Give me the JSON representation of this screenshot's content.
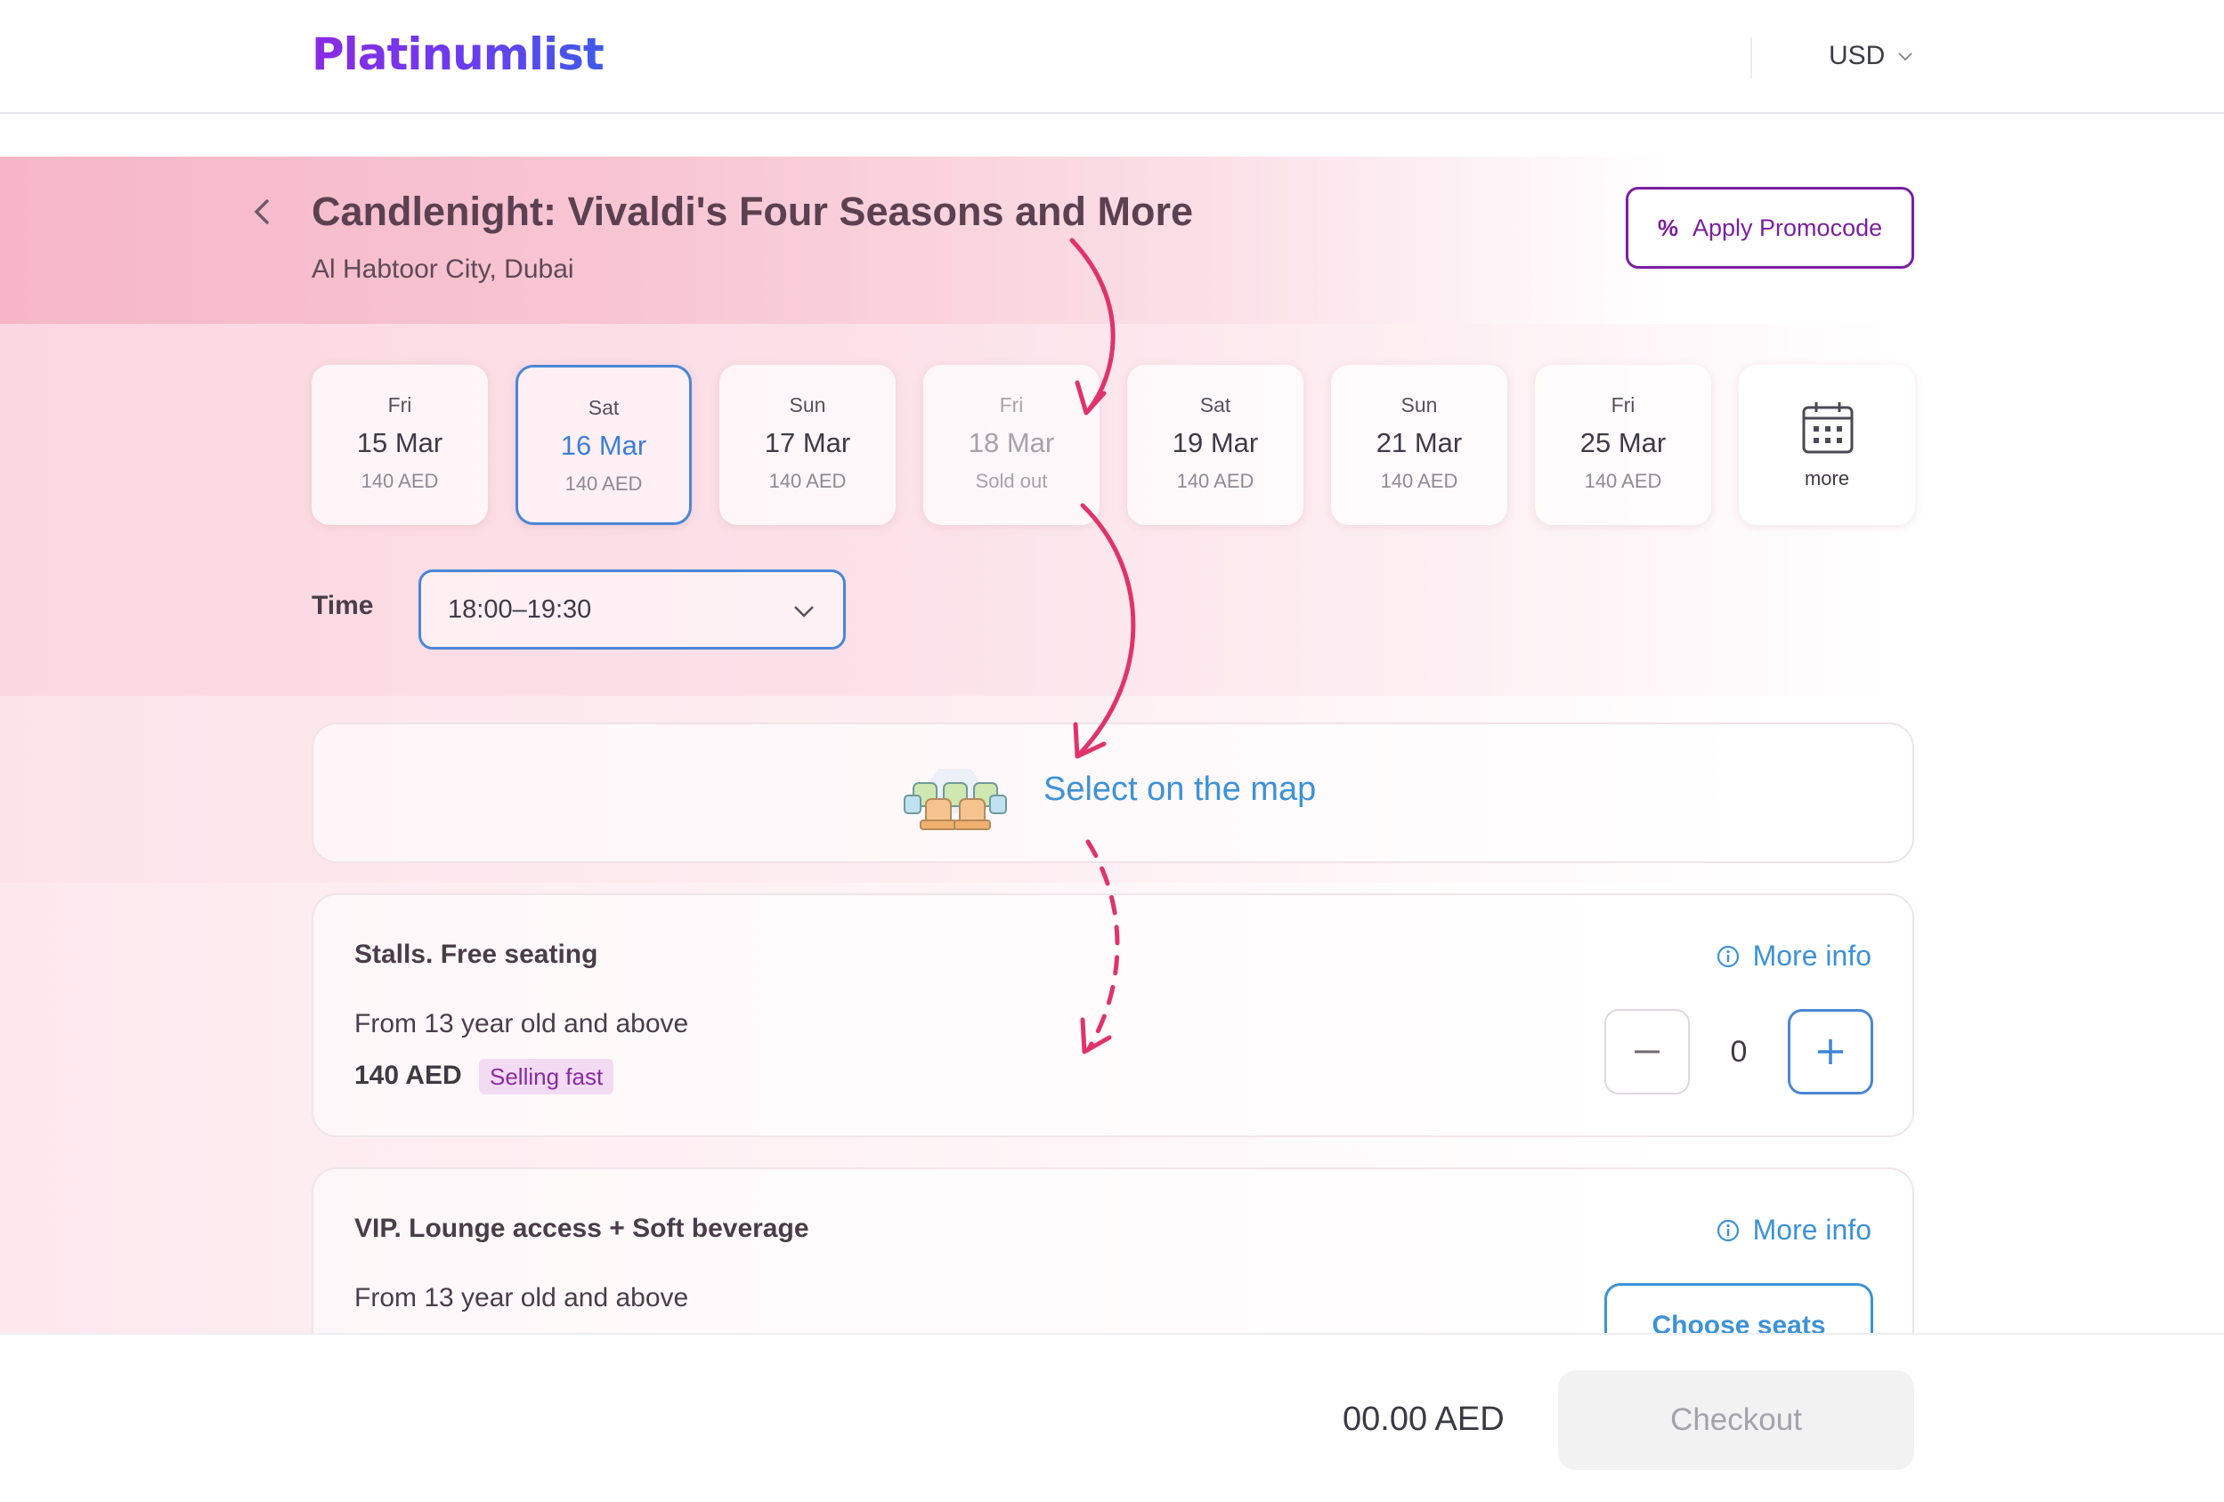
{
  "header": {
    "logo": "Platinumlist",
    "currency": "USD"
  },
  "event": {
    "title": "Candlenight: Vivaldi's Four Seasons and More",
    "venue": "Al Habtoor City, Dubai",
    "promo_label": "Apply Promocode"
  },
  "dates": [
    {
      "dow": "Fri",
      "date": "15 Mar",
      "price": "140 AED",
      "state": "available"
    },
    {
      "dow": "Sat",
      "date": "16 Mar",
      "price": "140 AED",
      "state": "selected"
    },
    {
      "dow": "Sun",
      "date": "17 Mar",
      "price": "140 AED",
      "state": "available"
    },
    {
      "dow": "Fri",
      "date": "18 Mar",
      "price": "Sold out",
      "state": "soldout"
    },
    {
      "dow": "Sat",
      "date": "19 Mar",
      "price": "140 AED",
      "state": "available"
    },
    {
      "dow": "Sun",
      "date": "21 Mar",
      "price": "140 AED",
      "state": "available"
    },
    {
      "dow": "Fri",
      "date": "25 Mar",
      "price": "140 AED",
      "state": "available"
    }
  ],
  "dates_more_label": "more",
  "time": {
    "label": "Time",
    "value": "18:00–19:30"
  },
  "map_select": {
    "label": "Select on the map"
  },
  "tickets": [
    {
      "name": "Stalls. Free seating",
      "age": "From 13 year old and above",
      "price": "140 AED",
      "badge": "Selling fast",
      "more_info": "More info",
      "quantity": "0"
    },
    {
      "name": "VIP. Lounge access + Soft beverage",
      "age": "From 13 year old and above",
      "more_info": "More info",
      "action": "Choose seats"
    }
  ],
  "footer": {
    "total": "00.00 AED",
    "checkout": "Checkout"
  },
  "colors": {
    "accent_blue": "#3d92d8",
    "brand_purple": "#7b1fa2",
    "annotation_pink": "#e0336a"
  }
}
